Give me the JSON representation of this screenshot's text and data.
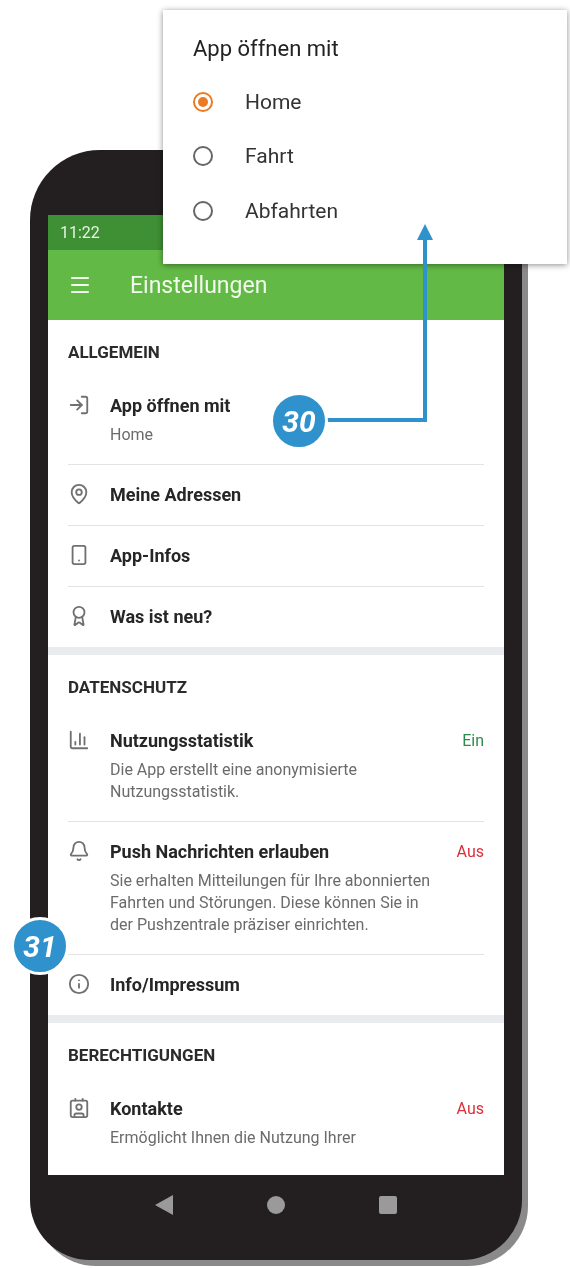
{
  "status_bar": {
    "time": "11:22"
  },
  "app_bar": {
    "title": "Einstellungen"
  },
  "sections": [
    {
      "title": "ALLGEMEIN",
      "items": [
        {
          "title": "App öffnen mit",
          "subtitle": "Home"
        },
        {
          "title": "Meine Adressen"
        },
        {
          "title": "App-Infos"
        },
        {
          "title": "Was ist neu?"
        }
      ]
    },
    {
      "title": "DATENSCHUTZ",
      "items": [
        {
          "title": "Nutzungsstatistik",
          "subtitle": "Die App erstellt eine anonymisierte Nutzungsstatistik.",
          "value": "Ein",
          "on": true
        },
        {
          "title": "Push Nachrichten erlauben",
          "subtitle": "Sie erhalten Mitteilungen für Ihre abonnierten Fahrten und Störungen. Diese können Sie in der Pushzentrale präziser einrichten.",
          "value": "Aus",
          "on": false
        },
        {
          "title": "Info/Impressum"
        }
      ]
    },
    {
      "title": "BERECHTIGUNGEN",
      "items": [
        {
          "title": "Kontakte",
          "subtitle": "Ermöglicht Ihnen die Nutzung Ihrer",
          "value": "Aus",
          "on": false
        }
      ]
    }
  ],
  "dialog": {
    "title": "App öffnen mit",
    "options": [
      {
        "label": "Home",
        "selected": true
      },
      {
        "label": "Fahrt",
        "selected": false
      },
      {
        "label": "Abfahrten",
        "selected": false
      }
    ]
  },
  "callouts": [
    {
      "label": "30"
    },
    {
      "label": "31"
    }
  ]
}
